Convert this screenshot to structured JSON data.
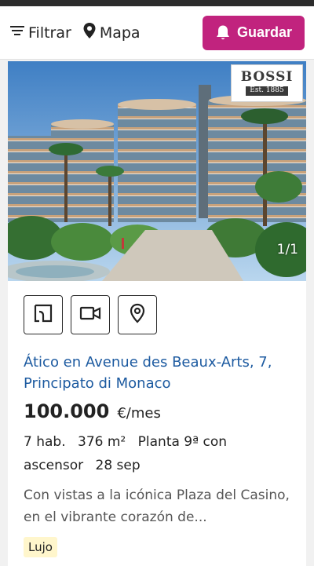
{
  "topbar": {
    "filter_label": "Filtrar",
    "map_label": "Mapa",
    "save_label": "Guardar",
    "accent_color": "#c1237e"
  },
  "listing": {
    "photo": {
      "logo_name": "BOSSI",
      "logo_est": "Est. 1885",
      "counter": "1/1"
    },
    "actions": [
      {
        "icon": "floorplan-icon"
      },
      {
        "icon": "video-icon"
      },
      {
        "icon": "location-pin-icon"
      }
    ],
    "title": "Ático en Avenue des Beaux-Arts, 7, Principato di Monaco",
    "price": "100.000",
    "price_unit": "€/mes",
    "details": {
      "rooms": "7 hab.",
      "area": "376 m²",
      "floor": "Planta 9ª con ascensor",
      "date": "28 sep"
    },
    "description": "Con vistas a la icónica Plaza del Casino, en el vibrante corazón de...",
    "badge": "Lujo",
    "title_color": "#1c5aa0"
  }
}
